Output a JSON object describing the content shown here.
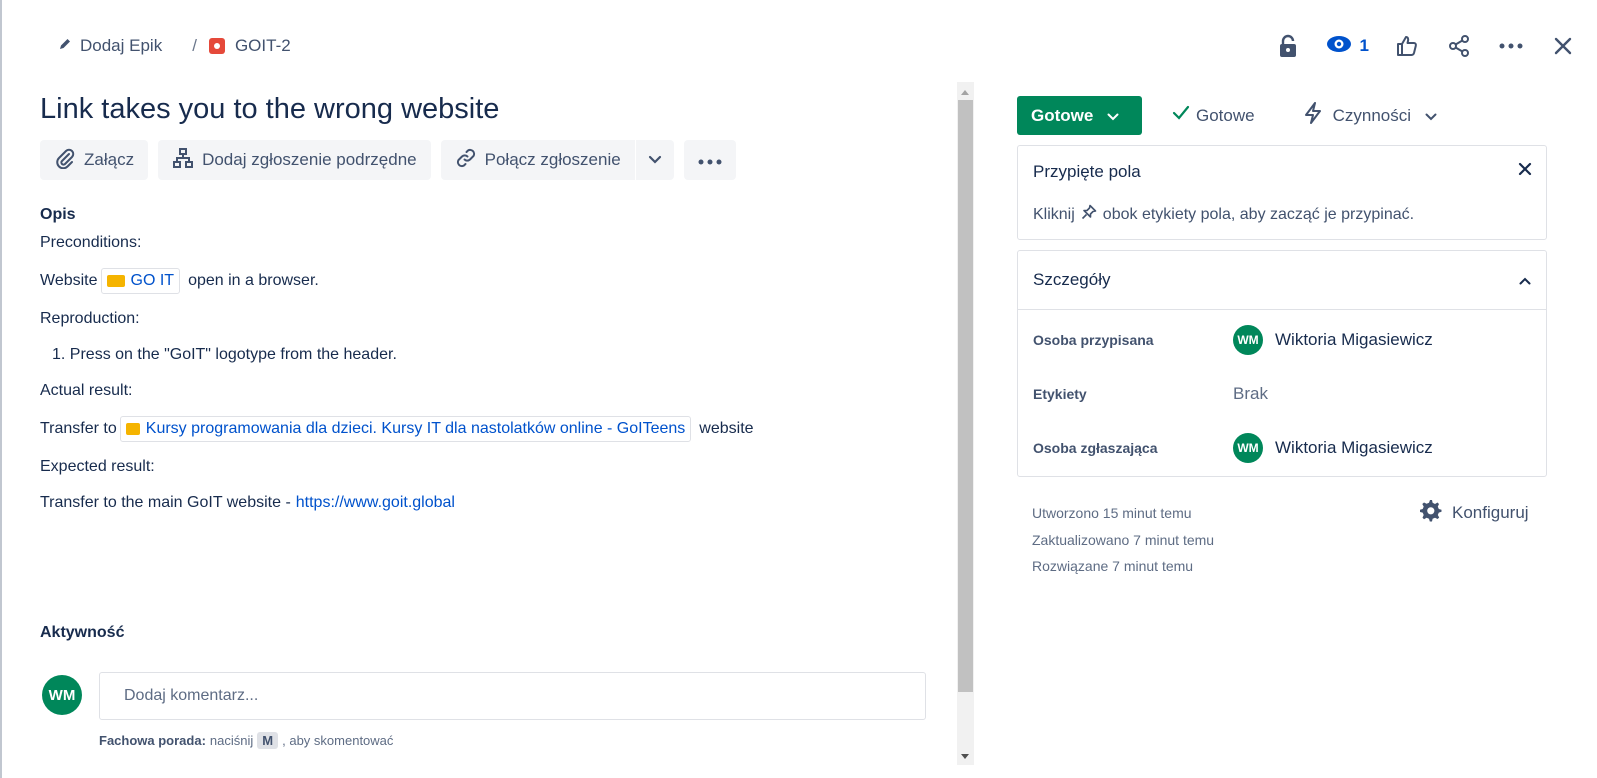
{
  "breadcrumbs": {
    "epic_label": "Dodaj Epik",
    "issue_key": "GOIT-2"
  },
  "header": {
    "watch_count": "1"
  },
  "issue": {
    "title": "Link takes you to the wrong website",
    "toolbar": {
      "attach": "Załącz",
      "add_child": "Dodaj zgłoszenie podrzędne",
      "link_issue": "Połącz zgłoszenie"
    },
    "description": {
      "heading": "Opis",
      "preconditions": "Preconditions:",
      "website_prefix": "Website",
      "website_link": "GO IT",
      "website_suffix": "open in a browser.",
      "reproduction": "Reproduction:",
      "step_1": "1. Press on the \"GoIT\" logotype from the header.",
      "actual": "Actual result:",
      "transfer_prefix": "Transfer to",
      "transfer_link": "Kursy programowania dla dzieci. Kursy IT dla nastolatków online - GoITeens",
      "transfer_suffix": "website",
      "expected": "Expected result:",
      "expected_text": "Transfer to the main GoIT website -",
      "expected_link": "https://www.goit.global"
    }
  },
  "activity": {
    "heading": "Aktywność",
    "avatar_initials": "WM",
    "comment_placeholder": "Dodaj komentarz...",
    "tip_bold": "Fachowa porada:",
    "tip_pre": "naciśnij",
    "tip_key": "M",
    "tip_post": ", aby skomentować"
  },
  "sidebar": {
    "status_button": "Gotowe",
    "resolution": "Gotowe",
    "actions": "Czynności",
    "pinned": {
      "title": "Przypięte pola",
      "text_pre": "Kliknij",
      "text_post": "obok etykiety pola, aby zacząć je przypinać."
    },
    "details": {
      "title": "Szczegóły",
      "assignee_label": "Osoba przypisana",
      "assignee_initials": "WM",
      "assignee_name": "Wiktoria Migasiewicz",
      "labels_label": "Etykiety",
      "labels_value": "Brak",
      "reporter_label": "Osoba zgłaszająca",
      "reporter_initials": "WM",
      "reporter_name": "Wiktoria Migasiewicz"
    },
    "meta": {
      "created": "Utworzono 15 minut temu",
      "updated": "Zaktualizowano 7 minut temu",
      "resolved": "Rozwiązane 7 minut temu"
    },
    "configure": "Konfiguruj"
  },
  "colors": {
    "status_green": "#00875A",
    "link_blue": "#0052CC",
    "text_dark": "#172B4D",
    "text_muted": "#5E6C84",
    "bug_red": "#E5493A"
  }
}
